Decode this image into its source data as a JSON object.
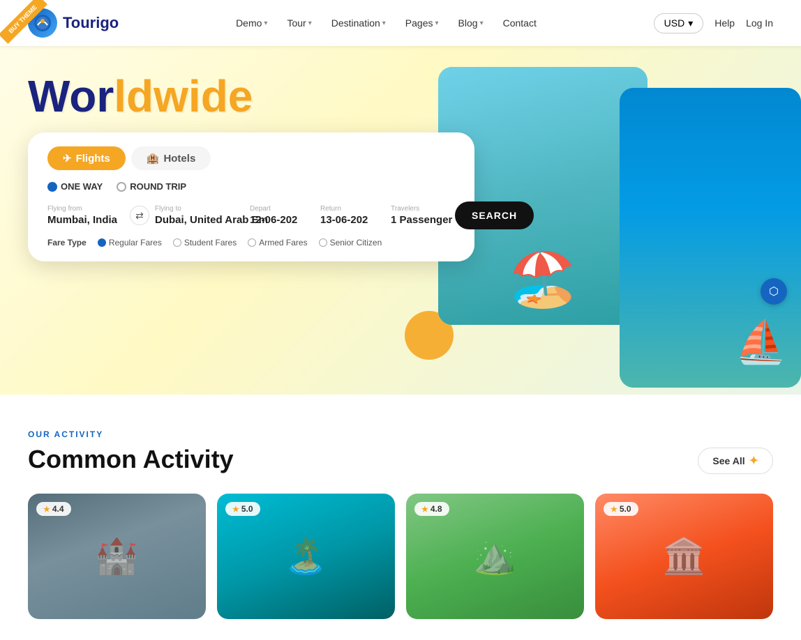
{
  "ribbon": {
    "text": "BUY THEME"
  },
  "navbar": {
    "logo_text": "Tourigo",
    "logo_icon": "T",
    "links": [
      {
        "id": "demo",
        "label": "Demo",
        "has_dropdown": true
      },
      {
        "id": "tour",
        "label": "Tour",
        "has_dropdown": true
      },
      {
        "id": "destination",
        "label": "Destination",
        "has_dropdown": true
      },
      {
        "id": "pages",
        "label": "Pages",
        "has_dropdown": true
      },
      {
        "id": "blog",
        "label": "Blog",
        "has_dropdown": true
      },
      {
        "id": "contact",
        "label": "Contact",
        "has_dropdown": false
      }
    ],
    "currency": "USD",
    "help": "Help",
    "login": "Log In"
  },
  "hero": {
    "title_line1": "Worldwide",
    "title_prefix": "Wor",
    "title_highlight": "ldwide"
  },
  "search_widget": {
    "tabs": [
      {
        "id": "flights",
        "label": "Flights",
        "active": true
      },
      {
        "id": "hotels",
        "label": "Hotels",
        "active": false
      }
    ],
    "trip_types": [
      {
        "id": "one-way",
        "label": "ONE WAY",
        "selected": true
      },
      {
        "id": "round-trip",
        "label": "ROUND TRIP",
        "selected": false
      }
    ],
    "fields": {
      "flying_from_label": "Flying from",
      "flying_from_value": "Mumbai, India",
      "flying_to_label": "Flying to",
      "flying_to_value": "Dubai, United Arab Em",
      "depart_label": "Depart",
      "depart_value": "12-06-202",
      "return_label": "Return",
      "return_value": "13-06-202",
      "travelers_label": "Travelers",
      "travelers_value": "1 Passenger"
    },
    "search_button": "SEARCH",
    "fare_types": [
      {
        "id": "regular",
        "label": "Regular Fares",
        "selected": true
      },
      {
        "id": "student",
        "label": "Student Fares",
        "selected": false
      },
      {
        "id": "armed",
        "label": "Armed Fares",
        "selected": false
      },
      {
        "id": "senior",
        "label": "Senior Citizen",
        "selected": false
      }
    ],
    "fare_label": "Fare Type"
  },
  "activity_section": {
    "label": "OUR ACTIVITY",
    "title": "Common Activity",
    "see_all": "See All",
    "cards": [
      {
        "id": "london",
        "rating": "4.4",
        "style": "london",
        "emoji": "🏰"
      },
      {
        "id": "maldives",
        "rating": "5.0",
        "style": "maldives",
        "emoji": "🏝️"
      },
      {
        "id": "mountain",
        "rating": "4.8",
        "style": "mountain",
        "emoji": "⛰️"
      },
      {
        "id": "europe",
        "rating": "5.0",
        "style": "europe",
        "emoji": "🏛️"
      }
    ]
  },
  "float_btn": {
    "icon": "⬛"
  }
}
